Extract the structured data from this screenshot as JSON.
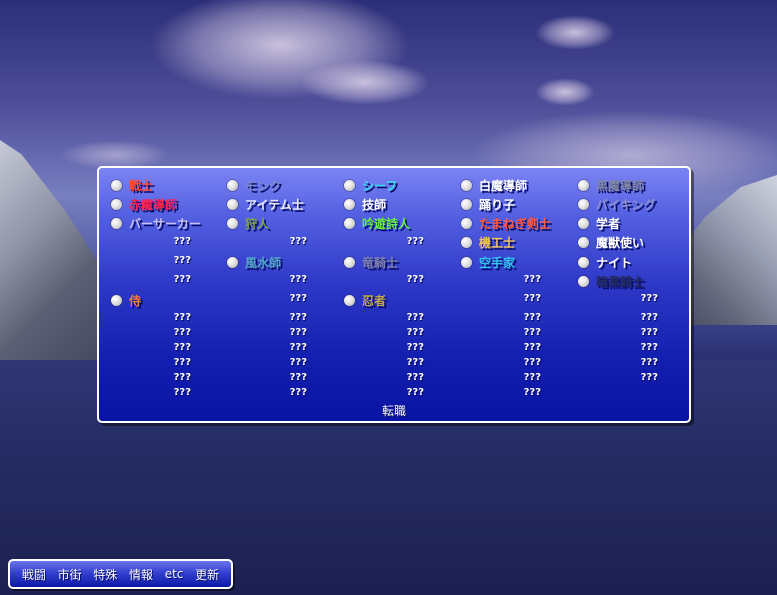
{
  "jobs": [
    {
      "label": "戦士",
      "color": "#ff4a3a",
      "col": 0,
      "row": 0
    },
    {
      "label": "モンク",
      "color": "#7f88c8",
      "col": 1,
      "row": 0
    },
    {
      "label": "シーフ",
      "color": "#33e0ea",
      "col": 2,
      "row": 0
    },
    {
      "label": "白魔導師",
      "color": "#ffffff",
      "col": 3,
      "row": 0
    },
    {
      "label": "黒魔導師",
      "color": "#8085a8",
      "col": 4,
      "row": 0
    },
    {
      "label": "赤魔導師",
      "color": "#ff2050",
      "col": 0,
      "row": 1
    },
    {
      "label": "アイテム士",
      "color": "#e8eaf6",
      "col": 1,
      "row": 1
    },
    {
      "label": "技師",
      "color": "#ffffff",
      "col": 2,
      "row": 1
    },
    {
      "label": "踊り子",
      "color": "#ffffff",
      "col": 3,
      "row": 1
    },
    {
      "label": "バイキング",
      "color": "#8b8fcf",
      "col": 4,
      "row": 1
    },
    {
      "label": "バーサーカー",
      "color": "#c8c2f4",
      "col": 0,
      "row": 2
    },
    {
      "label": "狩人",
      "color": "#7ea058",
      "col": 1,
      "row": 2
    },
    {
      "label": "吟遊詩人",
      "color": "#66ef44",
      "col": 2,
      "row": 2
    },
    {
      "label": "たまねぎ剣士",
      "color": "#ff5a40",
      "col": 3,
      "row": 2
    },
    {
      "label": "学者",
      "color": "#ffffff",
      "col": 4,
      "row": 2
    },
    {
      "label": "機工士",
      "color": "#f0c45a",
      "col": 3,
      "row": 3
    },
    {
      "label": "魔獣使い",
      "color": "#ffffff",
      "col": 4,
      "row": 3
    },
    {
      "label": "風水師",
      "color": "#54a6c6",
      "col": 1,
      "row": 4
    },
    {
      "label": "竜騎士",
      "color": "#7b7ea8",
      "col": 2,
      "row": 4
    },
    {
      "label": "空手家",
      "color": "#38c0f4",
      "col": 3,
      "row": 4
    },
    {
      "label": "ナイト",
      "color": "#ffffff",
      "col": 4,
      "row": 4
    },
    {
      "label": "暗黒騎士",
      "color": "#242a5a",
      "col": 4,
      "row": 5
    },
    {
      "label": "侍",
      "color": "#ff7a30",
      "col": 0,
      "row": 6
    },
    {
      "label": "忍者",
      "color": "#c0a84a",
      "col": 2,
      "row": 6
    }
  ],
  "unknown_label": "???",
  "unknown_cells": [
    [
      0,
      3
    ],
    [
      0,
      4
    ],
    [
      0,
      5
    ],
    [
      0,
      7
    ],
    [
      0,
      8
    ],
    [
      0,
      9
    ],
    [
      0,
      10
    ],
    [
      0,
      11
    ],
    [
      0,
      12
    ],
    [
      1,
      3
    ],
    [
      1,
      5
    ],
    [
      1,
      6
    ],
    [
      1,
      7
    ],
    [
      1,
      8
    ],
    [
      1,
      9
    ],
    [
      1,
      10
    ],
    [
      1,
      11
    ],
    [
      1,
      12
    ],
    [
      2,
      3
    ],
    [
      2,
      5
    ],
    [
      2,
      7
    ],
    [
      2,
      8
    ],
    [
      2,
      9
    ],
    [
      2,
      10
    ],
    [
      2,
      11
    ],
    [
      2,
      12
    ],
    [
      3,
      5
    ],
    [
      3,
      6
    ],
    [
      3,
      7
    ],
    [
      3,
      8
    ],
    [
      3,
      9
    ],
    [
      3,
      10
    ],
    [
      3,
      11
    ],
    [
      3,
      12
    ],
    [
      4,
      6
    ],
    [
      4,
      7
    ],
    [
      4,
      8
    ],
    [
      4,
      9
    ],
    [
      4,
      10
    ],
    [
      4,
      11
    ]
  ],
  "change_job_label": "転職",
  "nav": {
    "items": [
      "戦闘",
      "市街",
      "特殊",
      "情報",
      "etc",
      "更新"
    ]
  }
}
